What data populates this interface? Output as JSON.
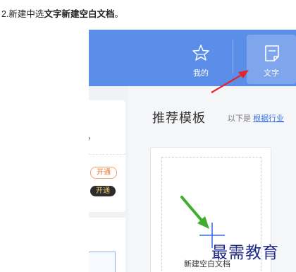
{
  "caption": {
    "prefix": "2.新建中选",
    "bold": "文字新建空白文档",
    "suffix": "。"
  },
  "topbar": {
    "items": [
      {
        "label": "我的",
        "icon": "star-icon"
      },
      {
        "label": "文字",
        "icon": "document-icon",
        "selected": true
      }
    ]
  },
  "left_panel": {
    "partial_text": "，",
    "badges": [
      {
        "label": "开通",
        "style": "outline"
      },
      {
        "label": "开通",
        "style": "dark"
      }
    ]
  },
  "main": {
    "title": "推荐模板",
    "subtitle_prefix": "以下是",
    "subtitle_link": "根据行业",
    "new_card": {
      "label": "新建空白文档"
    }
  },
  "watermark": "最需教育",
  "colors": {
    "topbar": "#5b8ee8",
    "arrow_red": "#e3262a",
    "arrow_green": "#3fae2c",
    "plus_blue": "#3b72e0",
    "watermark": "#1f2a8a"
  }
}
